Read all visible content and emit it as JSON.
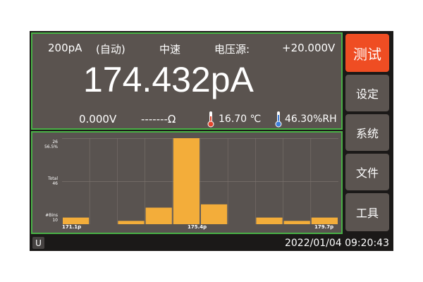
{
  "header": {
    "range": "200pA",
    "mode": "(自动)",
    "speed": "中速",
    "source_label": "电压源:",
    "source_value": "+20.000V"
  },
  "reading": {
    "value": "174.432pA"
  },
  "sub": {
    "voltage": "0.000V",
    "resistance": "-------Ω",
    "temperature": "16.70 ℃",
    "humidity": "46.30%RH"
  },
  "sidebar": {
    "items": [
      {
        "label": "测试",
        "active": true
      },
      {
        "label": "设定",
        "active": false
      },
      {
        "label": "系统",
        "active": false
      },
      {
        "label": "文件",
        "active": false
      },
      {
        "label": "工具",
        "active": false
      }
    ]
  },
  "status": {
    "usb": "U",
    "datetime": "2022/01/04 09:20:43"
  },
  "chart_data": {
    "type": "bar",
    "title": "",
    "y_labels": {
      "top": [
        "26",
        "56.5%"
      ],
      "mid": [
        "Total",
        "46"
      ],
      "bottom": [
        "#Bins",
        "10"
      ]
    },
    "x_ticks": [
      "171.1p",
      "175.4p",
      "179.7p"
    ],
    "bins": 10,
    "total": 46,
    "values": [
      2,
      0,
      1,
      5,
      26,
      6,
      0,
      2,
      1,
      2
    ],
    "ylim": [
      0,
      26
    ],
    "bar_color": "#f3ad3a",
    "grid": true
  },
  "colors": {
    "accent": "#ef4d23",
    "border": "#49b146",
    "panel": "#5a534f"
  }
}
